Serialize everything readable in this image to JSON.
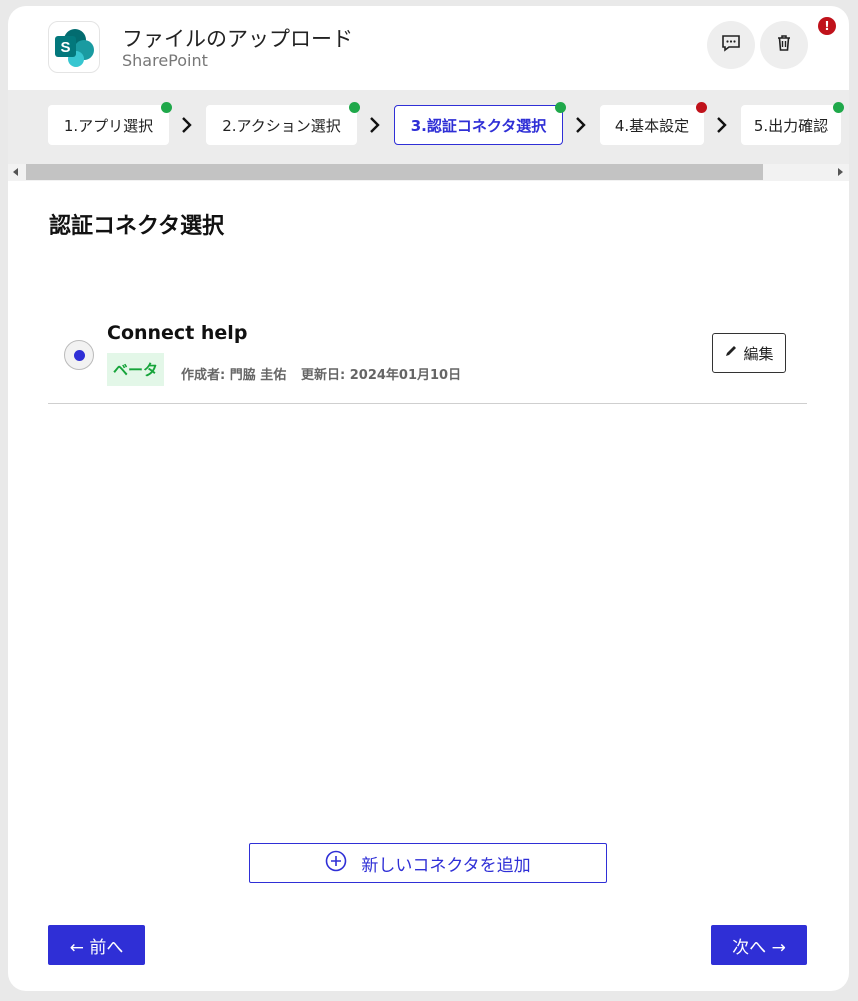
{
  "header": {
    "title": "ファイルのアップロード",
    "app_name": "SharePoint",
    "app_icon": "sharepoint-logo",
    "comment_icon": "comment-icon",
    "delete_icon": "trash-icon",
    "alert_badge": "!"
  },
  "steps": [
    {
      "label": "1.アプリ選択",
      "status": "done"
    },
    {
      "label": "2.アクション選択",
      "status": "done"
    },
    {
      "label": "3.認証コネクタ選択",
      "status": "done",
      "active": true
    },
    {
      "label": "4.基本設定",
      "status": "error"
    },
    {
      "label": "5.出力確認",
      "status": "done"
    }
  ],
  "section_title": "認証コネクタ選択",
  "connector": {
    "name": "Connect help",
    "badge": "ベータ",
    "author": "作成者: 門脇 圭佑",
    "updated": "更新日: 2024年01月10日",
    "edit_label": "編集",
    "selected": true
  },
  "add_connector_label": "新しいコネクタを追加",
  "nav": {
    "prev_label": "← 前へ",
    "next_label": "次へ →"
  },
  "colors": {
    "accent": "#2f2fd6",
    "success": "#1fa84a",
    "error": "#c0121b",
    "beta_bg": "#e3f7e8",
    "beta_text": "#16a43a"
  }
}
